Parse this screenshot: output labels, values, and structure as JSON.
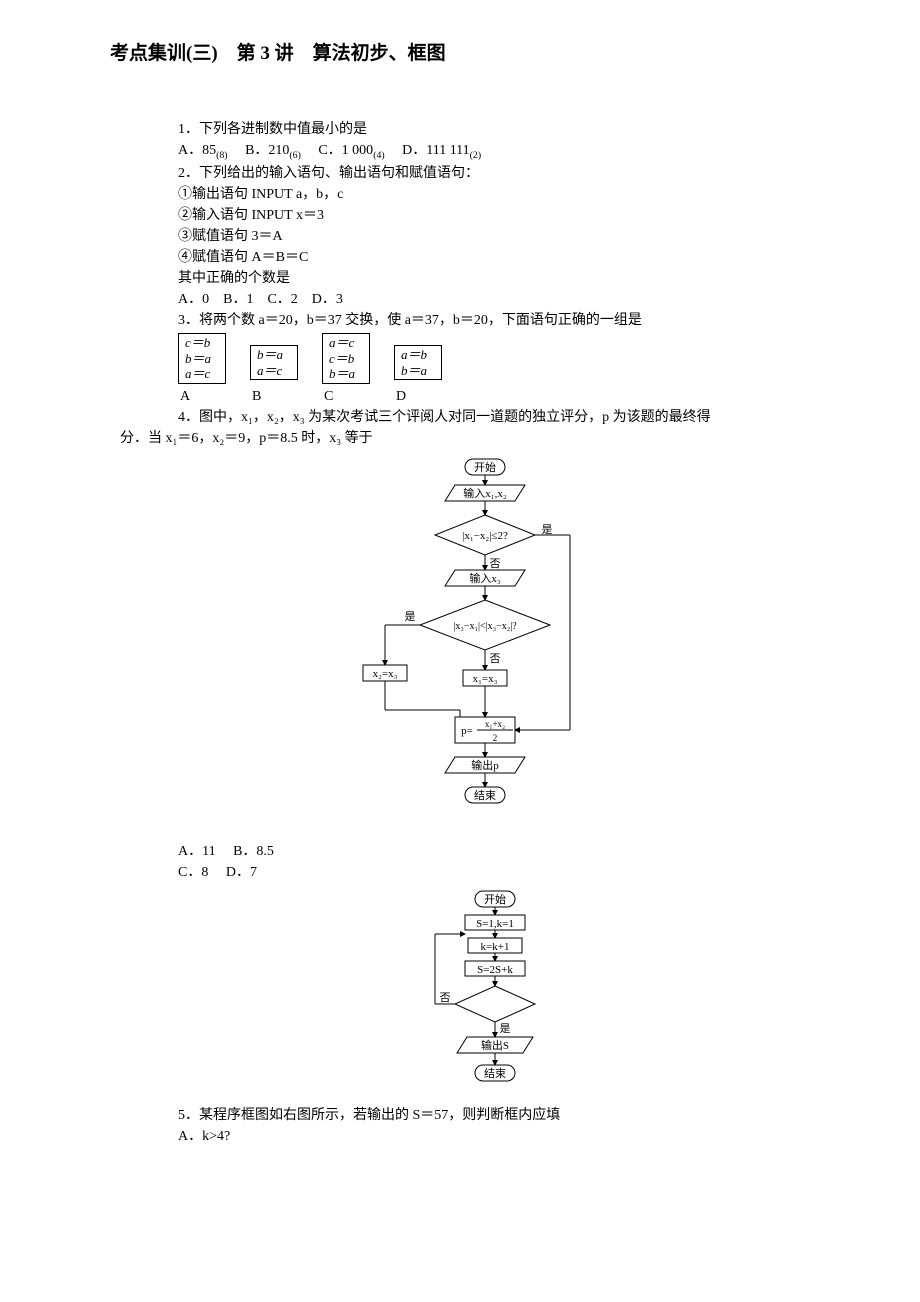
{
  "title": "考点集训(三)　第 3 讲　算法初步、框图",
  "q1": {
    "stem": "1．下列各进制数中值最小的是",
    "A": "A．85",
    "A_sub": "(8)",
    "B": "B．210",
    "B_sub": "(6)",
    "C": "C．1 000",
    "C_sub": "(4)",
    "D": "D．111 111",
    "D_sub": "(2)"
  },
  "q2": {
    "stem": "2．下列给出的输入语句、输出语句和赋值语句：",
    "l1": "①输出语句 INPUT a，b，c",
    "l2": "②输入语句 INPUT x＝3",
    "l3": "③赋值语句 3＝A",
    "l4": "④赋值语句 A＝B＝C",
    "ask": "其中正确的个数是",
    "opts": "A．0　B．1　C．2　D．3"
  },
  "q3": {
    "stem": "3．将两个数 a＝20，b＝37 交换，使 a＝37，b＝20，下面语句正确的一组是",
    "boxA": "c＝b\nb＝a\na＝c",
    "boxB": "b＝a\na＝c",
    "boxC": "a＝c\nc＝b\nb＝a",
    "boxD": "a＝b\nb＝a",
    "lblA": "A",
    "lblB": "B",
    "lblC": "C",
    "lblD": "D"
  },
  "q4": {
    "stem_a": "4．图中，x₁，x₂，x₃ 为某次考试三个评阅人对同一道题的独立评分，p 为该题的最终得",
    "stem_b": "分．当 x₁＝6，x₂＝9，p＝8.5 时，x₃ 等于",
    "optA": "A．11",
    "optB": "B．8.5",
    "optC": "C．8",
    "optD": "D．7",
    "flow": {
      "start": "开始",
      "in12": "输入x₁,x₂",
      "d1": "|x₁−x₂|≤2?",
      "yes": "是",
      "no": "否",
      "in3": "输入x₃",
      "d2": "|x₃−x₁|<|x₃−x₂|?",
      "asgn2": "x₂=x₃",
      "asgn1": "x₁=x₃",
      "pcalc_l": "p=",
      "pcalc_num": "x₁+x₂",
      "pcalc_den": "2",
      "outp": "输出p",
      "end": "结束"
    }
  },
  "q5": {
    "stem": "5．某程序框图如右图所示，若输出的 S＝57，则判断框内应填",
    "optA": "A．k>4?",
    "flow": {
      "start": "开始",
      "init": "S=1,k=1",
      "inc": "k=k+1",
      "upd": "S=2S+k",
      "yes": "是",
      "no": "否",
      "out": "输出S",
      "end": "结束"
    }
  }
}
